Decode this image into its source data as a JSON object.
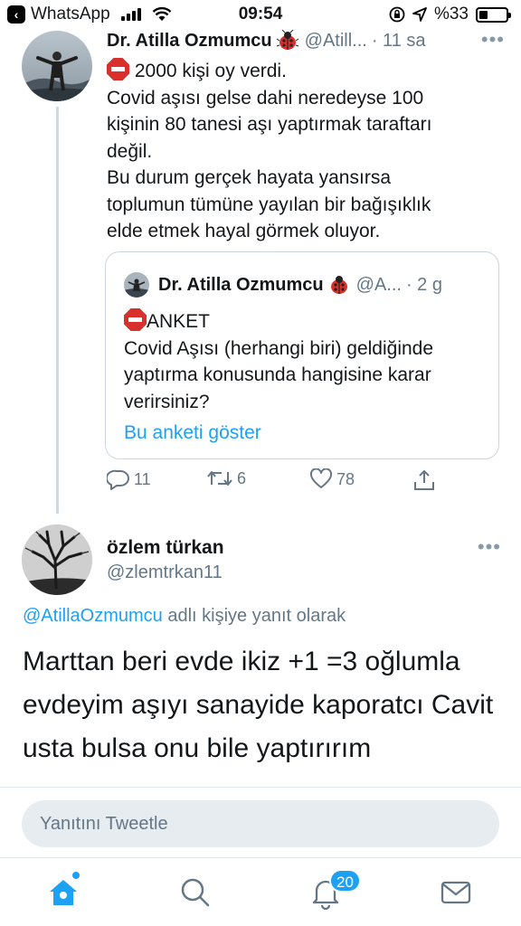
{
  "status_bar": {
    "back_app": "WhatsApp",
    "time": "09:54",
    "battery_text": "%33",
    "battery_level": 0.33
  },
  "tweet1": {
    "name": "Dr. Atilla Ozmumcu",
    "handle": "@Atill...",
    "time": "· 11 sa",
    "lines": [
      "2000 kişi oy verdi.",
      "Covid aşısı gelse dahi neredeyse 100",
      "kişinin 80 tanesi aşı yaptırmak taraftarı",
      "değil.",
      "Bu durum gerçek hayata yansırsa",
      "toplumun tümüne yayılan bir bağışıklık",
      "elde etmek hayal görmek oluyor."
    ],
    "quote": {
      "name": "Dr. Atilla Ozmumcu",
      "handle": "@A...",
      "time": "· 2 g",
      "lines": [
        "ANKET",
        "Covid Aşısı (herhangi biri) geldiğinde",
        "yaptırma konusunda hangisine karar",
        "verirsiniz?"
      ],
      "poll_link": "Bu anketi göster"
    },
    "actions": {
      "replies": "11",
      "retweets": "6",
      "likes": "78"
    }
  },
  "tweet2": {
    "name": "özlem türkan",
    "handle": "@zlemtrkan11",
    "reply_mention": "@AtillaOzmumcu",
    "reply_suffix": " adlı kişiye yanıt olarak",
    "lines": [
      "Marttan beri evde ikiz +1 =3 oğlumla",
      "evdeyim aşıyı sanayide kaporatcı Cavit",
      "usta bulsa onu bile yaptırırım"
    ]
  },
  "reply_box": {
    "placeholder": "Yanıtını Tweetle"
  },
  "tabbar": {
    "notification_count": "20"
  },
  "colors": {
    "accent": "#1da1f2",
    "text": "#14171a",
    "secondary": "#657786",
    "stop_sign": "#d9302c"
  }
}
